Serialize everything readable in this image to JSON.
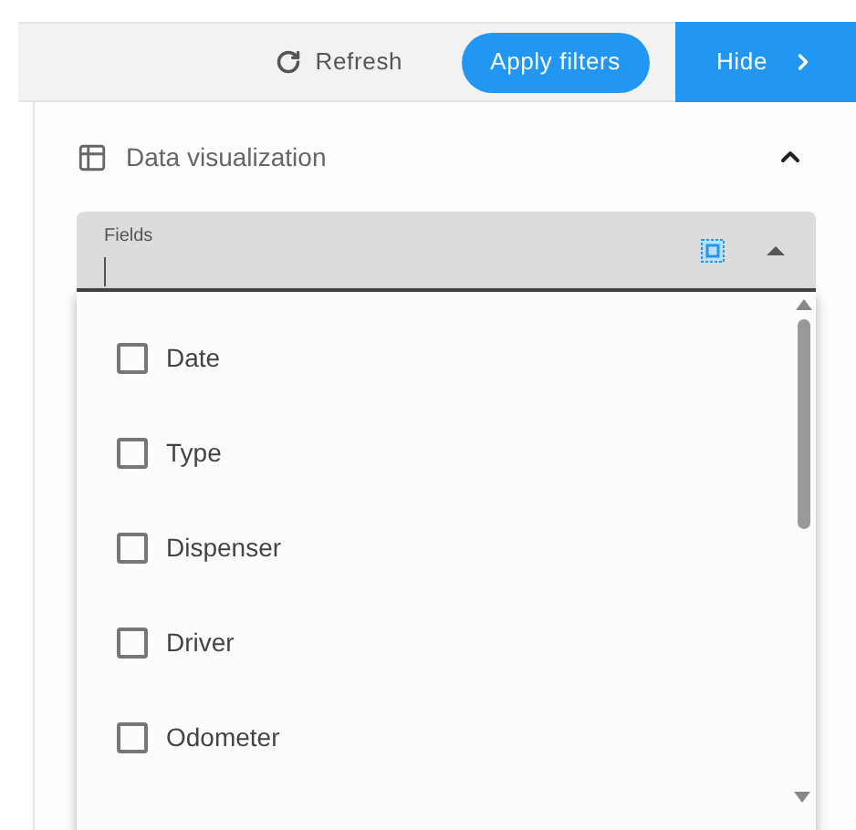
{
  "toolbar": {
    "refresh": "Refresh",
    "apply": "Apply filters",
    "hide": "Hide"
  },
  "section": {
    "title": "Data visualization",
    "expanded": true
  },
  "fields": {
    "label": "Fields",
    "open": true
  },
  "options": [
    {
      "label": "Date",
      "checked": false
    },
    {
      "label": "Type",
      "checked": false
    },
    {
      "label": "Dispenser",
      "checked": false
    },
    {
      "label": "Driver",
      "checked": false
    },
    {
      "label": "Odometer",
      "checked": false
    }
  ]
}
